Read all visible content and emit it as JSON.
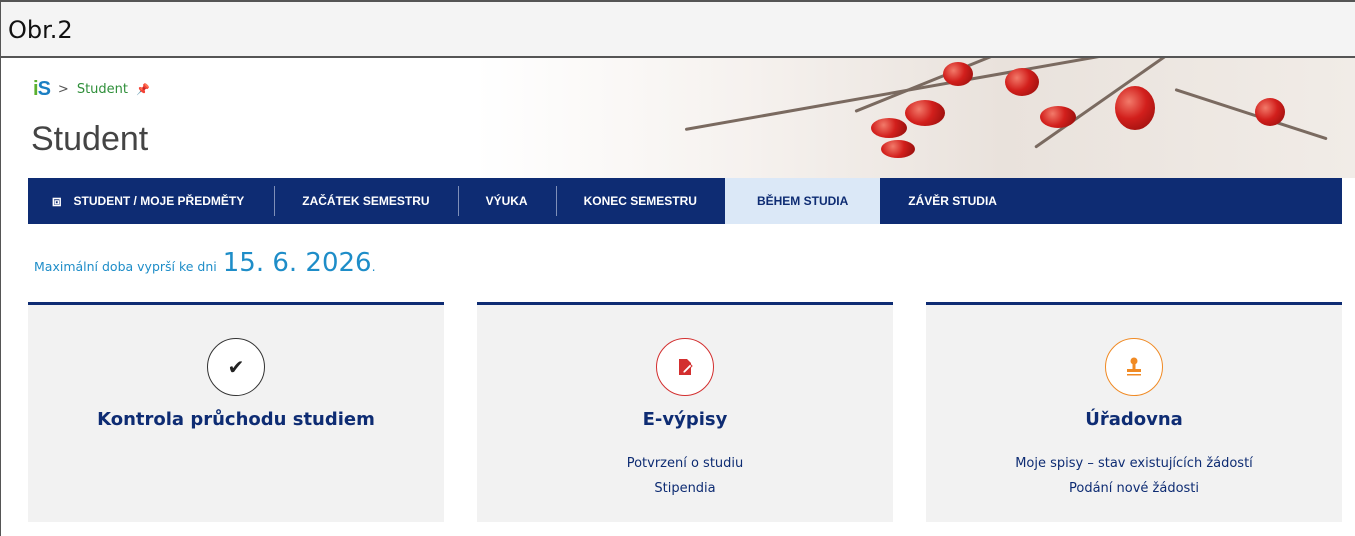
{
  "caption": "Obr.2",
  "breadcrumb": {
    "logo_i": "i",
    "logo_s": "S",
    "separator": ">",
    "current": "Student",
    "pin_icon": "pin-icon"
  },
  "page_title": "Student",
  "nav": [
    {
      "label": "STUDENT / MOJE PŘEDMĚTY",
      "icon": "signpost-icon",
      "active": false
    },
    {
      "label": "ZAČÁTEK SEMESTRU",
      "active": false
    },
    {
      "label": "VÝUKA",
      "active": false
    },
    {
      "label": "KONEC SEMESTRU",
      "active": false
    },
    {
      "label": "BĚHEM STUDIA",
      "active": true
    },
    {
      "label": "ZÁVĚR STUDIA",
      "active": false
    }
  ],
  "deadline": {
    "prefix": "Maximální doba vyprší ke dni",
    "date": "15. 6. 2026",
    "suffix": "."
  },
  "cards": [
    {
      "title": "Kontrola průchodu studiem",
      "icon": "check-icon",
      "icon_color": "#222222",
      "links": []
    },
    {
      "title": "E-výpisy",
      "icon": "document-edit-icon",
      "icon_color": "#d32f2f",
      "links": [
        "Potvrzení o studiu",
        "Stipendia"
      ]
    },
    {
      "title": "Úřadovna",
      "icon": "stamp-icon",
      "icon_color": "#f08a24",
      "links": [
        "Moje spisy – stav existujících žádostí",
        "Podání nové žádosti"
      ]
    }
  ],
  "colors": {
    "nav_bg": "#0e2c73",
    "nav_active_bg": "#dbe8f7",
    "accent_blue": "#1e8dc8",
    "card_bg": "#f2f2f2",
    "link_green": "#2f8f3a"
  }
}
